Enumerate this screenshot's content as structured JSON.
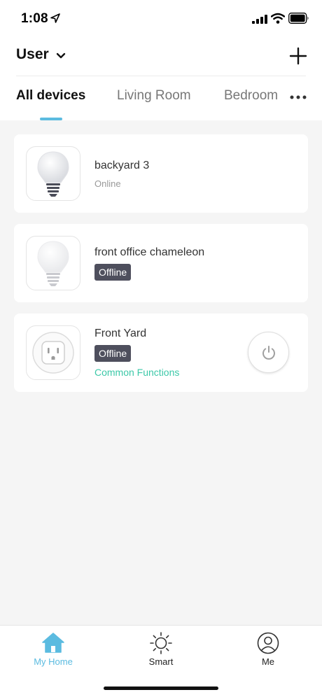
{
  "status_bar": {
    "time": "1:08",
    "icons": [
      "location-arrow-icon",
      "signal-icon",
      "wifi-icon",
      "battery-icon"
    ]
  },
  "header": {
    "home_name": "User",
    "icons": [
      "chevron-down-icon",
      "add-icon"
    ]
  },
  "tabs": [
    {
      "label": "All devices",
      "active": true
    },
    {
      "label": "Living Room",
      "active": false
    },
    {
      "label": "Bedroom",
      "active": false
    }
  ],
  "devices": [
    {
      "name": "backyard 3",
      "status": "Online",
      "icon": "light-bulb-icon"
    },
    {
      "name": "front office chameleon",
      "status": "Offline",
      "icon": "light-bulb-icon"
    },
    {
      "name": "Front Yard",
      "status": "Offline",
      "icon": "smart-plug-icon",
      "link": "Common Functions",
      "action_icon": "power-icon"
    }
  ],
  "bottom_nav": [
    {
      "label": "My Home",
      "icon": "home-icon",
      "active": true
    },
    {
      "label": "Smart",
      "icon": "sun-icon",
      "active": false
    },
    {
      "label": "Me",
      "icon": "profile-icon",
      "active": false
    }
  ],
  "colors": {
    "accent": "#5bbbe0",
    "link": "#3cc8a8",
    "offline_badge": "#4e4f5d",
    "background": "#f5f5f5"
  }
}
